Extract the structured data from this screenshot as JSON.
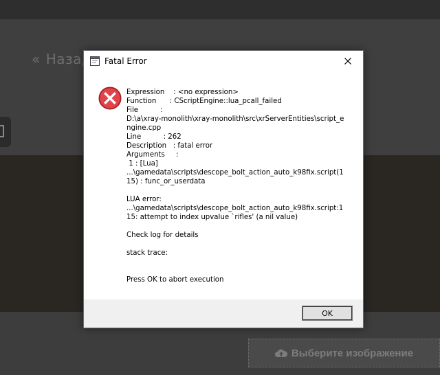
{
  "background": {
    "back_link": "Назад",
    "upload_button_label": "Выберите изображение"
  },
  "dialog": {
    "title": "Fatal Error",
    "message": "Expression    : <no expression>\nFunction      : CScriptEngine::lua_pcall_failed\nFile          :\nD:\\a\\xray-monolith\\xray-monolith\\src\\xrServerEntities\\script_engine.cpp\nLine          : 262\nDescription   : fatal error\nArguments     :\n 1 : [Lua]\n...\\gamedata\\scripts\\descope_bolt_action_auto_k98fix.script(115) : func_or_userdata\n\nLUA error:\n...\\gamedata\\scripts\\descope_bolt_action_auto_k98fix.script:115: attempt to index upvalue `rifles' (a nil value)\n\nCheck log for details\n\nstack trace:\n\n\nPress OK to abort execution",
    "ok_label": "OK"
  },
  "colors": {
    "error_red": "#d9363e",
    "dialog_bg": "#ffffff",
    "footer_bg": "#f0f0f0"
  }
}
